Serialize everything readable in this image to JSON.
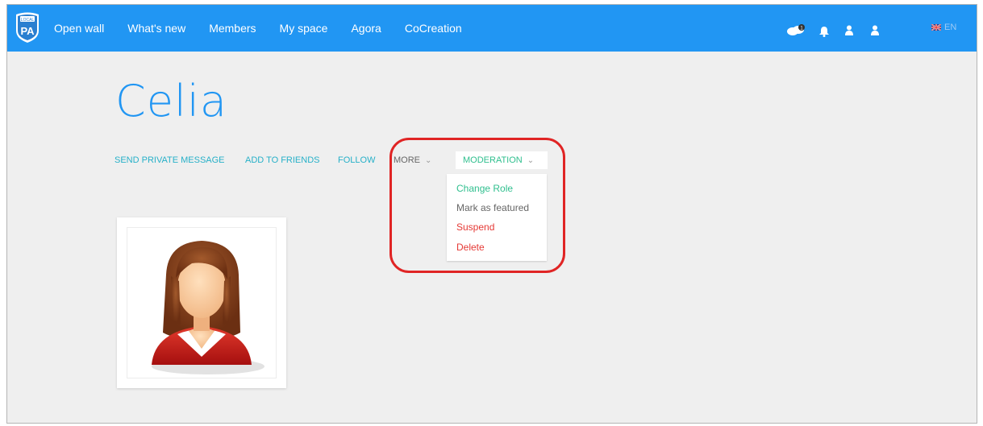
{
  "nav": {
    "logo_top": "LOCAL",
    "logo_text": "PA",
    "items": [
      "Open wall",
      "What's new",
      "Members",
      "My space",
      "Agora",
      "CoCreation"
    ]
  },
  "header_icons": {
    "messages_icon": "chat-bubbles-icon",
    "messages_badge": "1",
    "notifications_icon": "bell-icon",
    "friends_icon": "person-icon",
    "profile_icon": "person-icon",
    "language": "EN"
  },
  "profile": {
    "name": "Celia",
    "actions": {
      "send_message": "SEND PRIVATE MESSAGE",
      "add_friend": "ADD TO FRIENDS",
      "follow": "FOLLOW",
      "more": "MORE"
    },
    "moderation_label": "MODERATION",
    "moderation_menu": [
      "Change Role",
      "Mark as featured",
      "Suspend",
      "Delete"
    ]
  },
  "colors": {
    "topbar": "#2196f3",
    "link": "#26b0c8",
    "green": "#2fbf8e",
    "danger": "#e53935",
    "highlight": "#e02424"
  }
}
